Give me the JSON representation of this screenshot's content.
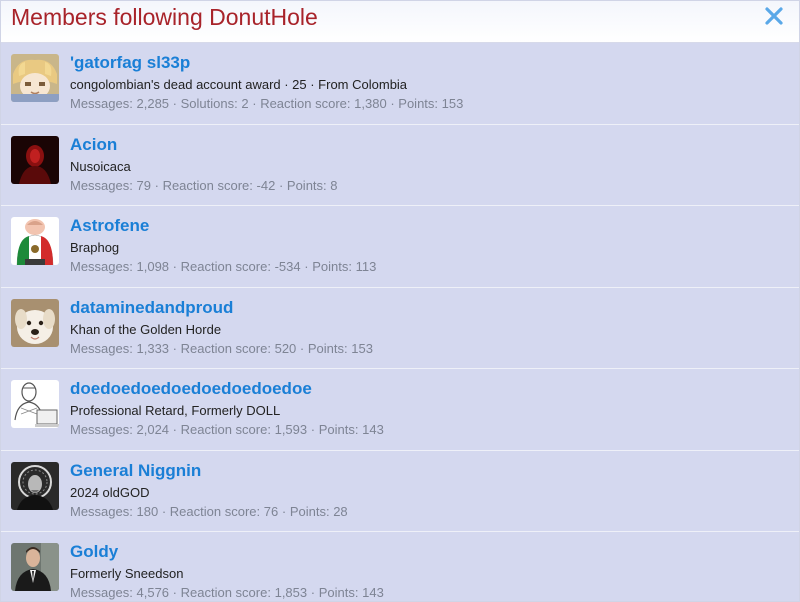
{
  "dialog": {
    "title": "Members following DonutHole",
    "close_icon": "close-icon",
    "accent_color": "#a8232a",
    "link_color": "#1a7fd6"
  },
  "labels": {
    "messages": "Messages:",
    "solutions": "Solutions:",
    "reaction_score": "Reaction score:",
    "points": "Points:",
    "sep": "·"
  },
  "members": [
    {
      "name": "'gatorfag sl33p",
      "blurb": "congolombian's dead account award · 25 · From Colombia",
      "messages": "2,285",
      "solutions": "2",
      "reaction_score": "1,380",
      "points": "153",
      "avatar": "avatar-anime"
    },
    {
      "name": "Acion",
      "blurb": "Nusoicaca",
      "messages": "79",
      "reaction_score": "-42",
      "points": "8",
      "avatar": "avatar-red-figure"
    },
    {
      "name": "Astrofene",
      "blurb": "Braphog",
      "messages": "1,098",
      "reaction_score": "-534",
      "points": "113",
      "avatar": "avatar-mexico-figure"
    },
    {
      "name": "dataminedandproud",
      "blurb": "Khan of the Golden Horde",
      "messages": "1,333",
      "reaction_score": "520",
      "points": "153",
      "avatar": "avatar-dog"
    },
    {
      "name": "doedoedoedoedoedoedoedoe",
      "blurb": "Professional Retard, Formerly DOLL",
      "messages": "2,024",
      "reaction_score": "1,593",
      "points": "143",
      "avatar": "avatar-sketch"
    },
    {
      "name": "General Niggnin",
      "blurb": "2024 oldGOD",
      "messages": "180",
      "reaction_score": "76",
      "points": "28",
      "avatar": "avatar-portrait-bw"
    },
    {
      "name": "Goldy",
      "blurb": "Formerly Sneedson",
      "messages": "4,576",
      "reaction_score": "1,853",
      "points": "143",
      "avatar": "avatar-man-suit"
    }
  ]
}
